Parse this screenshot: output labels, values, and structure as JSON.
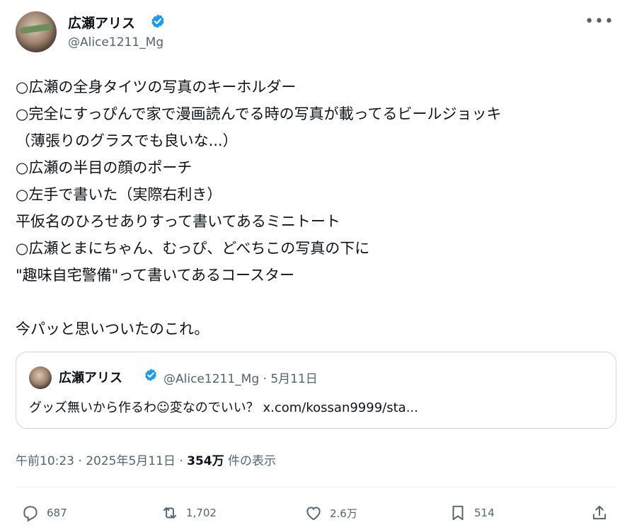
{
  "author": {
    "name": "広瀬アリス",
    "handle": "@Alice1211_Mg"
  },
  "tweet": {
    "lines": [
      "○広瀬の全身タイツの写真のキーホルダー",
      "○完全にすっぴんで家で漫画読んでる時の写真が載ってるビールジョッキ",
      "（薄張りのグラスでも良いな...）",
      "○広瀬の半目の顔のポーチ",
      "○左手で書いた（実際右利き）",
      "平仮名のひろせありすって書いてあるミニトート",
      "○広瀬とまにちゃん、むっぴ、どべちこの写真の下に",
      "\"趣味自宅警備\"って書いてあるコースター",
      "",
      "今パッと思いついたのこれ。"
    ]
  },
  "quote": {
    "name": "広瀬アリス",
    "handle_date": "@Alice1211_Mg · 5月11日",
    "text": "グッズ無いから作るわ☺変なのでいい？ x.com/kossan9999/sta..."
  },
  "meta": {
    "time": "午前10:23 · 2025年5月11日 · ",
    "views": "354万",
    "views_suffix": " 件の表示"
  },
  "actions": {
    "replies": "687",
    "reposts": "1,702",
    "likes": "2.6万",
    "bookmarks": "514"
  },
  "colors": {
    "verified": "#1d9bf0",
    "secondary_text": "#536471",
    "border": "#cfd9de"
  }
}
